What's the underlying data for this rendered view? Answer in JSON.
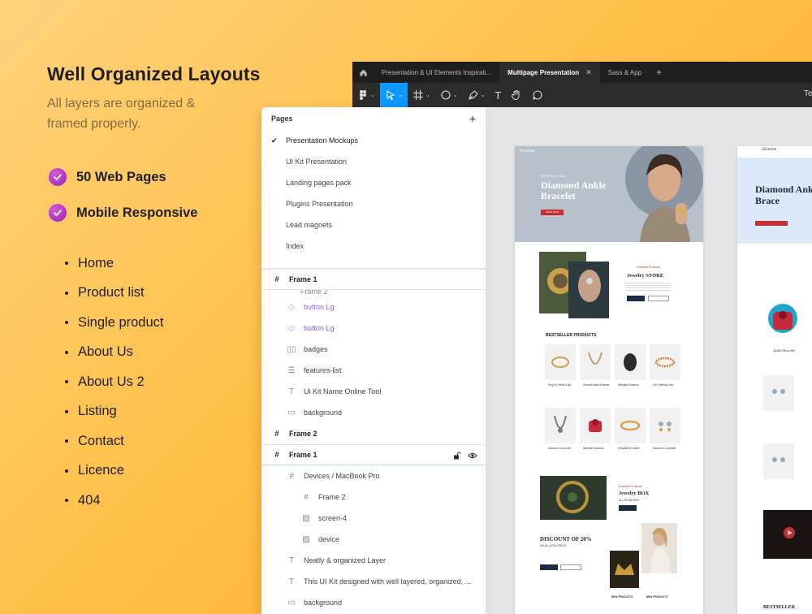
{
  "hero": {
    "title": "Well Organized Layouts",
    "subtitle": "All layers are organized & framed properly."
  },
  "features": [
    {
      "label": "50 Web Pages"
    },
    {
      "label": "Mobile Responsive"
    }
  ],
  "page_list": [
    "Home",
    "Product list",
    "Single product",
    "About Us",
    "About Us 2",
    "Listing",
    "Contact",
    "Licence",
    "404"
  ],
  "figma": {
    "tabs": [
      {
        "label": "Presentation & UI Elements Inspirati..."
      },
      {
        "label": "Multipage Presentation",
        "active": true
      },
      {
        "label": "Sass & App"
      }
    ],
    "toolbar_right_text": "Te",
    "pages_panel": {
      "title": "Pages",
      "pages": [
        {
          "label": "Presentation Mockups",
          "active": true
        },
        {
          "label": "UI Kit Presentation"
        },
        {
          "label": "Landing pages pack"
        },
        {
          "label": "Plugins Presentation"
        },
        {
          "label": "Lead magnets"
        },
        {
          "label": "Index"
        }
      ]
    },
    "layers": {
      "frame1_top": "Frame 1",
      "clipped": "Frame 2",
      "items": [
        {
          "label": "button Lg",
          "type": "component"
        },
        {
          "label": "button Lg",
          "type": "component"
        },
        {
          "label": "badges",
          "type": "columns"
        },
        {
          "label": "features-list",
          "type": "rows"
        },
        {
          "label": "Ui Kit Name Online Tool",
          "type": "text"
        },
        {
          "label": "background",
          "type": "rect"
        }
      ],
      "frame2": "Frame 2",
      "frame1_selected": "Frame 1",
      "children": [
        {
          "label": "Devices / MacBook Pro",
          "type": "frame",
          "depth": 1
        },
        {
          "label": "Frame 2",
          "type": "frame",
          "depth": 2
        },
        {
          "label": "screen-4",
          "type": "image",
          "depth": 2
        },
        {
          "label": "device",
          "type": "image",
          "depth": 2
        },
        {
          "label": "Neatly & organized Layer",
          "type": "text",
          "depth": 1
        },
        {
          "label": "This UI Kit designed with well layered, organized, ...",
          "type": "text",
          "depth": 1
        },
        {
          "label": "background",
          "type": "rect",
          "depth": 1
        }
      ]
    }
  },
  "canvas": {
    "board1": {
      "brand": "Silverbin",
      "badge": "IN SPRING 2024",
      "title": "Diamond Ankle Bracelet",
      "cta": "SHOP NOW",
      "featured": "Featured Products",
      "store_title": "Jewelry STORE",
      "bestseller": "BESTSELLER PRODUCTS",
      "products_row1": [
        "Ring 3K White Gold",
        "Sereina Ankle Bracelet",
        "Mirealite Diamond",
        "14K Sterling Gold"
      ],
      "products_row2": [
        "Diamond Cut Anklet",
        "Mirealite Diamond",
        "Versatile 6K Anklet",
        "Diamond Cut Anklet"
      ],
      "box_title": "Jewelry BOX",
      "box_sub": "ALL IN ONE BOX",
      "discount_title": "DISCOUNT OF 20%",
      "discount_sub": "ON ALL GOLD RINGS",
      "new_products": "NEW PRODUCTS"
    },
    "board2": {
      "brand": "Silverbin",
      "title": "Diamond Ankle Brace",
      "bestseller": "BESTSELLER",
      "item": "Ankle Bracelet"
    }
  },
  "colors": {
    "accent_check": "#a52bbd",
    "figma_blue": "#0d99ff",
    "component_purple": "#7b61ff"
  }
}
